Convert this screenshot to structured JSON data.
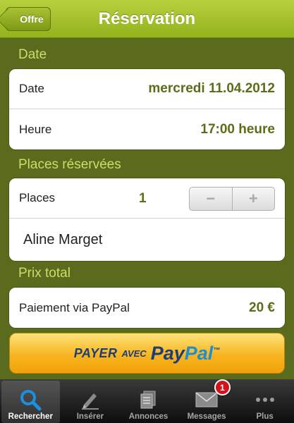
{
  "nav": {
    "back_label": "Offre",
    "title": "Réservation"
  },
  "sections": {
    "date_header": "Date",
    "places_header": "Places réservées",
    "price_header": "Prix total"
  },
  "date_group": {
    "date_label": "Date",
    "date_value": "mercredi 11.04.2012",
    "time_label": "Heure",
    "time_value": "17:00 heure"
  },
  "places_group": {
    "places_label": "Places",
    "places_count": "1",
    "stepper_minus": "−",
    "stepper_plus": "+",
    "passenger_name": "Aline Marget"
  },
  "price_group": {
    "payment_label": "Paiement via PayPal",
    "price_value": "20 €"
  },
  "paypal_button": {
    "pay": "PAYER",
    "avec": "AVEC",
    "logo_pay": "Pay",
    "logo_pal": "Pal",
    "logo_tm": "™"
  },
  "tabbar": {
    "tabs": [
      {
        "label": "Rechercher",
        "icon": "search-icon",
        "active": true
      },
      {
        "label": "Insérer",
        "icon": "pencil-icon",
        "active": false
      },
      {
        "label": "Annonces",
        "icon": "documents-icon",
        "active": false
      },
      {
        "label": "Messages",
        "icon": "envelope-icon",
        "active": false,
        "badge": "1"
      },
      {
        "label": "Plus",
        "icon": "more-icon",
        "active": false
      }
    ]
  },
  "colors": {
    "accent_green": "#5b6d18",
    "nav_green": "#a5c232",
    "paypal_orange": "#f8b51f"
  }
}
